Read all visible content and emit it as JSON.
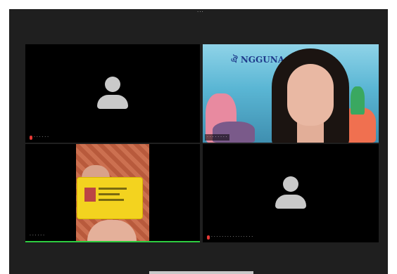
{
  "window": {
    "menu_glyph": "···"
  },
  "participants": [
    {
      "id": "p1",
      "name": "· · · · · ·",
      "video": "off"
    },
    {
      "id": "p2",
      "name": "· · · · · · · ·",
      "video": "on",
      "scene": "underwater-background"
    },
    {
      "id": "p3",
      "name": "· · · · · ·",
      "video": "on",
      "scene": "holding-id-card",
      "speaking": true
    },
    {
      "id": "p4",
      "name": "· · · · · · · · · · · · · · · ·",
      "video": "off"
    }
  ],
  "background_logo_text": "ঐ NGGUNA",
  "colors": {
    "active_speaker": "#2ecc40",
    "muted_mic": "#e53935",
    "window_bg": "#1f1f1f",
    "tile_bg": "#000000"
  }
}
